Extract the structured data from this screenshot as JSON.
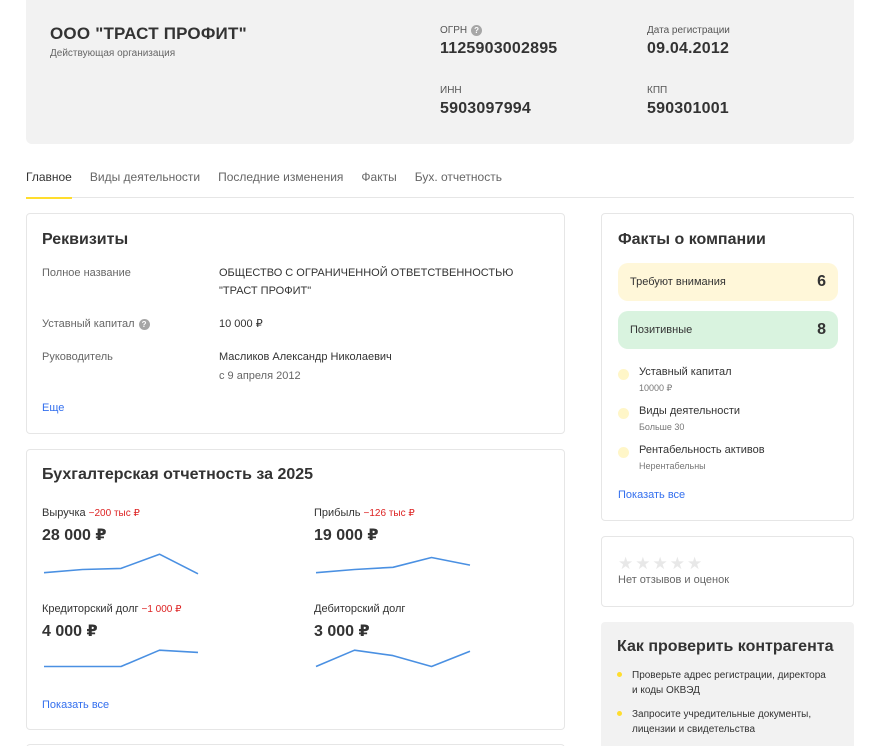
{
  "company": {
    "name": "ООО \"ТРАСТ ПРОФИТ\"",
    "status": "Действующая организация",
    "ogrn_label": "ОГРН",
    "ogrn": "1125903002895",
    "reg_date_label": "Дата регистрации",
    "reg_date": "09.04.2012",
    "inn_label": "ИНН",
    "inn": "5903097994",
    "kpp_label": "КПП",
    "kpp": "590301001"
  },
  "tabs": [
    {
      "label": "Главное",
      "active": true
    },
    {
      "label": "Виды деятельности",
      "active": false
    },
    {
      "label": "Последние изменения",
      "active": false
    },
    {
      "label": "Факты",
      "active": false
    },
    {
      "label": "Бух. отчетность",
      "active": false
    }
  ],
  "requisites": {
    "title": "Реквизиты",
    "full_name_label": "Полное название",
    "full_name_line1": "ОБЩЕСТВО С ОГРАНИЧЕННОЙ ОТВЕТСТВЕННОСТЬЮ",
    "full_name_line2": "\"ТРАСТ ПРОФИТ\"",
    "capital_label": "Уставный капитал",
    "capital": "10 000 ₽",
    "director_label": "Руководитель",
    "director": "Масликов Александр Николаевич",
    "director_since": "с 9 апреля 2012",
    "more_link": "Еще"
  },
  "accounting": {
    "title": "Бухгалтерская отчетность за 2025",
    "show_all": "Показать все",
    "metrics": [
      {
        "label": "Выручка",
        "delta": "−200 тыс ₽",
        "value": "28 000 ₽",
        "trend": [
          3,
          6,
          7,
          20,
          2
        ]
      },
      {
        "label": "Прибыль",
        "delta": "−126 тыс ₽",
        "value": "19 000 ₽",
        "trend": [
          3,
          6,
          8,
          17,
          10
        ]
      },
      {
        "label": "Кредиторский долг",
        "delta": "−1 000 ₽",
        "value": "4 000 ₽",
        "trend": [
          5,
          5,
          5,
          20,
          18
        ]
      },
      {
        "label": "Дебиторский долг",
        "delta": "",
        "value": "3 000 ₽",
        "trend": [
          5,
          20,
          15,
          5,
          19
        ]
      }
    ],
    "line_color": "#4a90e2"
  },
  "facts": {
    "title": "Факты о компании",
    "attention_label": "Требуют внимания",
    "attention_count": "6",
    "positive_label": "Позитивные",
    "positive_count": "8",
    "attention_color": "#fff7d9",
    "positive_color": "#d9f3df",
    "items": [
      {
        "title": "Уставный капитал",
        "sub": "10000 ₽"
      },
      {
        "title": "Виды деятельности",
        "sub": "Больше 30"
      },
      {
        "title": "Рентабельность активов",
        "sub": "Нерентабельны"
      }
    ],
    "show_all": "Показать все"
  },
  "reviews": {
    "stars": 5,
    "text": "Нет отзывов и оценок"
  },
  "check": {
    "title": "Как проверить контрагента",
    "items": [
      {
        "line1": "Проверьте адрес регистрации, директора",
        "line2": "и коды ОКВЭД"
      },
      {
        "line1": "Запросите учредительные документы,",
        "line2": "лицензии и свидетельства"
      }
    ]
  }
}
